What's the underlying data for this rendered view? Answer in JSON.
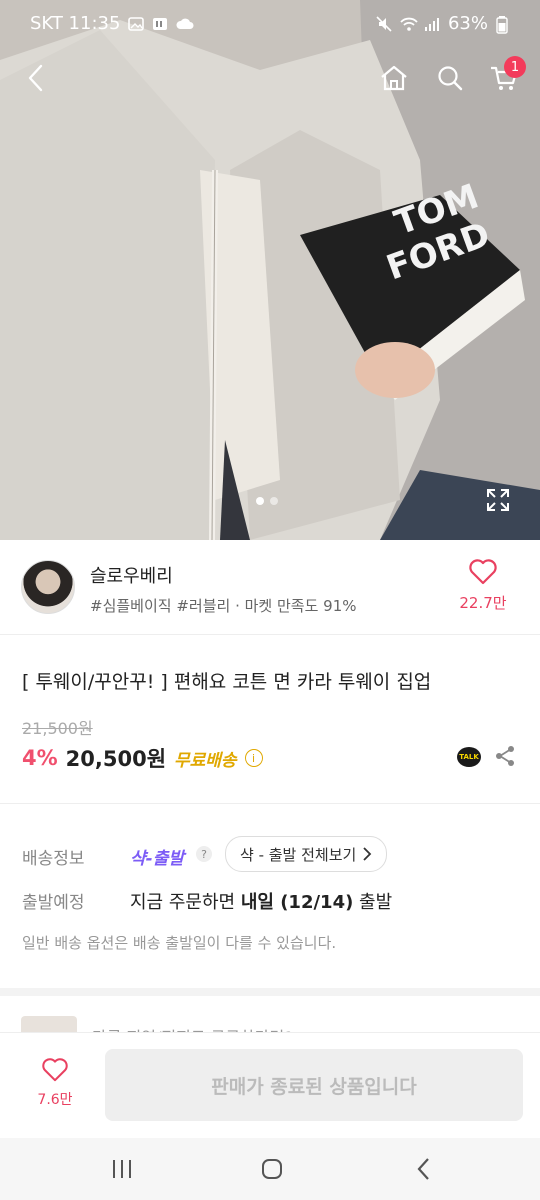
{
  "status_bar": {
    "carrier_time": "SKT 11:35",
    "battery": "63%"
  },
  "nav": {
    "cart_count": "1"
  },
  "shop": {
    "name": "슬로우베리",
    "tags": "#심플베이직 #러블리 · 마켓 만족도 91%",
    "likes": "22.7만"
  },
  "product": {
    "title": "[ 투웨이/꾸안꾸! ] 편해요 코튼 면 카라 투웨이 집업",
    "original_price": "21,500원",
    "discount": "4%",
    "price": "20,500원",
    "free_shipping": "무료배송",
    "talk_label": "TALK"
  },
  "shipping": {
    "label_info": "배송정보",
    "saak_badge": "샥-출발",
    "help_mark": "?",
    "chip_label": "샥 - 출발 전체보기",
    "label_depart": "출발예정",
    "depart_prefix": "지금 주문하면 ",
    "depart_bold": "내일 (12/14)",
    "depart_suffix": " 출발",
    "note": "일반 배송 옵션은 배송 출발일이 다를 수 있습니다."
  },
  "peek": {
    "text": "다른 지역/전지도 궁금하다면?"
  },
  "bottom": {
    "likes": "7.6만",
    "soldout_label": "판매가 종료된 상품입니다"
  },
  "colors": {
    "accent_pink": "#f0506e",
    "saak_purple": "#7c5cf6",
    "free_yellow": "#e0a800"
  }
}
